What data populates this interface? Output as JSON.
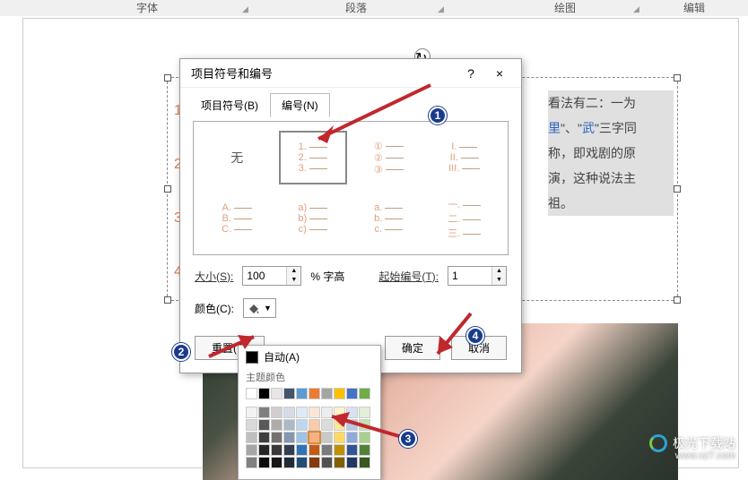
{
  "ribbon": {
    "font_group": "字体",
    "paragraph_group": "段落",
    "drawing_group": "绘图",
    "editing_group": "编辑"
  },
  "doc_numbers": [
    "1",
    "2",
    "3",
    "4"
  ],
  "doc_text": {
    "line1_a": "看法有二：一为",
    "line1_b": "\"、\"",
    "line1_c": "武",
    "line1_d": "\"三字同",
    "line2": "称，即戏剧的原",
    "line3": "演，这种说法主",
    "line4": "祖。"
  },
  "dialog": {
    "title": "项目符号和编号",
    "help": "?",
    "close": "×",
    "tabs": {
      "bullets": "项目符号(B)",
      "numbering": "编号(N)"
    },
    "none_label": "无",
    "styles": {
      "arabic_dot": [
        "1.",
        "2.",
        "3."
      ],
      "circled": [
        "①",
        "②",
        "③"
      ],
      "upper_roman": [
        "I.",
        "II.",
        "III."
      ],
      "upper_alpha": [
        "A.",
        "B.",
        "C."
      ],
      "lower_alpha_paren": [
        "a)",
        "b)",
        "c)"
      ],
      "lower_alpha_dot": [
        "a.",
        "b.",
        "c."
      ],
      "chinese": [
        "一.",
        "二.",
        "三."
      ]
    },
    "size_label": "大小(S):",
    "size_value": "100",
    "size_unit": "% 字高",
    "start_label": "起始编号(T):",
    "start_value": "1",
    "color_label": "颜色(C):",
    "reset": "重置(E)",
    "ok": "确定",
    "cancel": "取消"
  },
  "color_popup": {
    "auto": "自动(A)",
    "theme_section": "主题颜色",
    "theme_row": [
      "#ffffff",
      "#000000",
      "#e7e6e6",
      "#44546a",
      "#5b9bd5",
      "#ed7d31",
      "#a5a5a5",
      "#ffc000",
      "#4472c4",
      "#70ad47"
    ],
    "shades": [
      [
        "#f2f2f2",
        "#7f7f7f",
        "#d0cece",
        "#d6dce5",
        "#deebf7",
        "#fbe5d6",
        "#ededed",
        "#fff2cc",
        "#d9e2f3",
        "#e2efda"
      ],
      [
        "#d9d9d9",
        "#595959",
        "#aeabab",
        "#adb9ca",
        "#bdd7ee",
        "#f8cbad",
        "#dbdbdb",
        "#ffe699",
        "#b4c7e7",
        "#c5e0b4"
      ],
      [
        "#bfbfbf",
        "#3f3f3f",
        "#757171",
        "#8497b0",
        "#9dc3e6",
        "#f4b183",
        "#c9c9c9",
        "#ffd966",
        "#8faadc",
        "#a9d18e"
      ],
      [
        "#a6a6a6",
        "#262626",
        "#3a3838",
        "#333f50",
        "#2e75b6",
        "#c55a11",
        "#7b7b7b",
        "#bf9000",
        "#2f5597",
        "#548235"
      ],
      [
        "#808080",
        "#0d0d0d",
        "#171717",
        "#222a35",
        "#1f4e79",
        "#843c0c",
        "#525252",
        "#806000",
        "#203864",
        "#385723"
      ]
    ],
    "selected": [
      2,
      5
    ]
  },
  "annotations": {
    "a1": "1",
    "a2": "2",
    "a3": "3",
    "a4": "4"
  },
  "watermark": {
    "name": "极光下载站",
    "url": "www.xz7.com"
  }
}
